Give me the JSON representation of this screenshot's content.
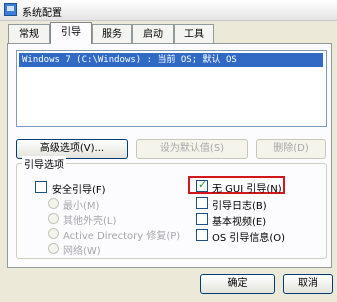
{
  "window": {
    "title": "系统配置"
  },
  "tabs": [
    {
      "label": "常规"
    },
    {
      "label": "引导"
    },
    {
      "label": "服务"
    },
    {
      "label": "启动"
    },
    {
      "label": "工具"
    }
  ],
  "os_list": {
    "entries": [
      "Windows 7 (C:\\Windows) : 当前 OS; 默认 OS"
    ]
  },
  "buttons": {
    "advanced": "高级选项(V)...",
    "set_default": "设为默认值(S)",
    "delete": "删除(D)",
    "ok": "确定",
    "cancel": "取消"
  },
  "boot_options": {
    "group_label": "引导选项",
    "safe_boot": {
      "label": "安全引导(F)",
      "checked": false
    },
    "safe_modes": [
      "最小(M)",
      "其他外壳(L)",
      "Active Directory 修复(P)",
      "网络(W)"
    ],
    "no_gui": {
      "label": "无 GUI 引导(N)",
      "checked": true
    },
    "boot_log": {
      "label": "引导日志(B)",
      "checked": false
    },
    "base_video": {
      "label": "基本视频(E)",
      "checked": false
    },
    "os_info": {
      "label": "OS 引导信息(O)",
      "checked": false
    }
  },
  "colors": {
    "highlight": "#d3161b",
    "selection": "#316ac5"
  }
}
